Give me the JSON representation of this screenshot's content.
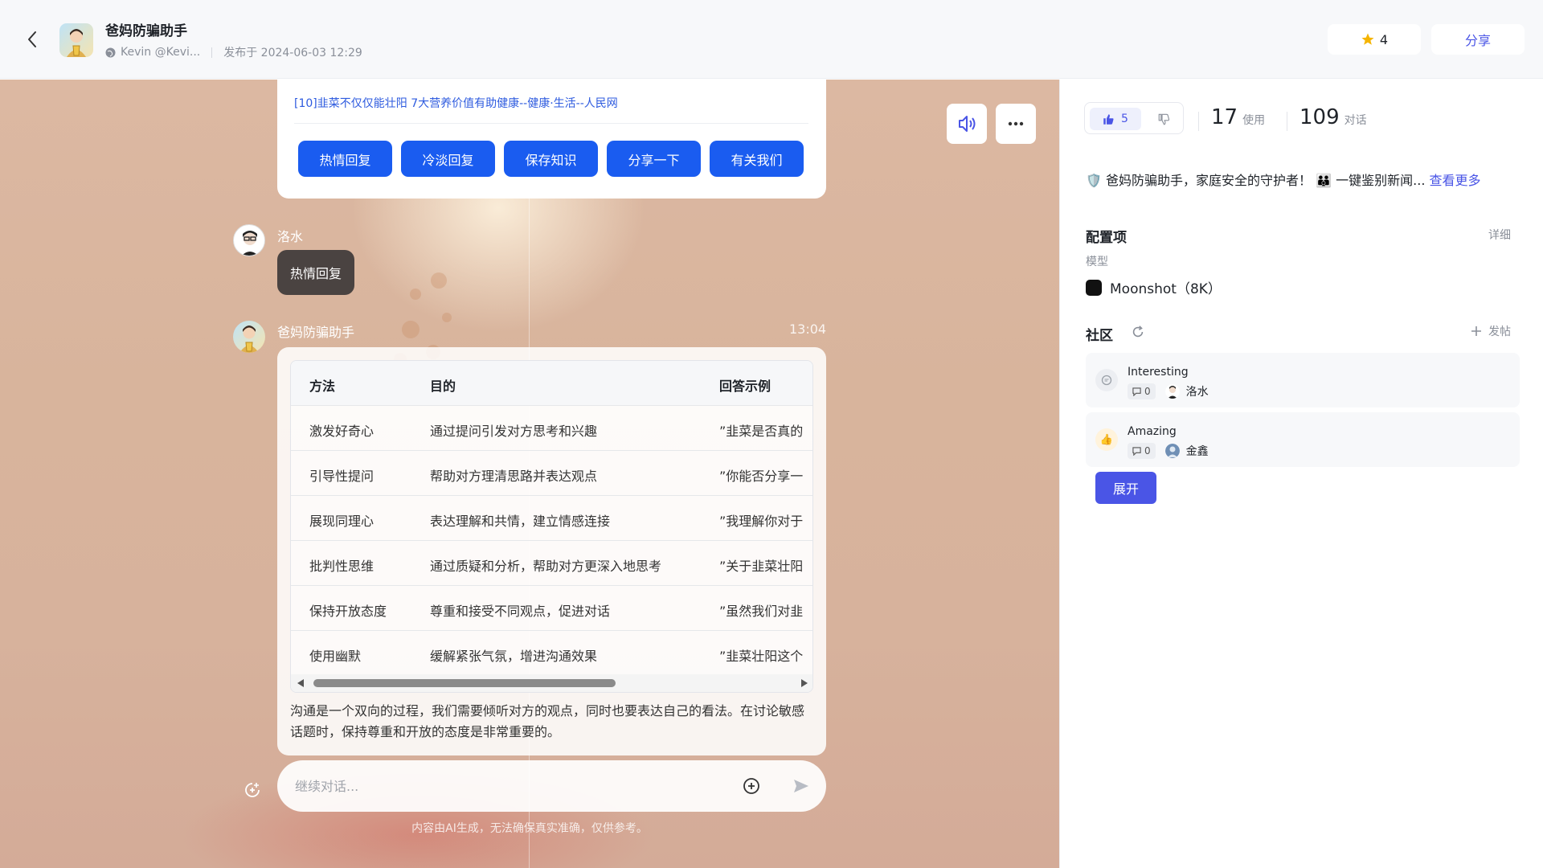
{
  "header": {
    "title": "爸妈防骗助手",
    "author": "Kevin @Kevi...",
    "published": "发布于 2024-06-03 12:29",
    "star_count": "4",
    "share_label": "分享"
  },
  "chat": {
    "reference_link": "[10]韭菜不仅仅能壮阳 7大营养价值有助健康--健康·生活--人民网",
    "quick_replies": [
      "热情回复",
      "冷淡回复",
      "保存知识",
      "分享一下",
      "有关我们"
    ],
    "user_message": {
      "name": "洛水",
      "text": "热情回复"
    },
    "bot_message": {
      "name": "爸妈防骗助手",
      "time": "13:04",
      "table": {
        "headers": [
          "方法",
          "目的",
          "回答示例"
        ],
        "rows": [
          [
            "激发好奇心",
            "通过提问引发对方思考和兴趣",
            "”韭菜是否真的"
          ],
          [
            "引导性提问",
            "帮助对方理清思路并表达观点",
            "”你能否分享一"
          ],
          [
            "展现同理心",
            "表达理解和共情，建立情感连接",
            "”我理解你对于"
          ],
          [
            "批判性思维",
            "通过质疑和分析，帮助对方更深入地思考",
            "”关于韭菜壮阳"
          ],
          [
            "保持开放态度",
            "尊重和接受不同观点，促进对话",
            "”虽然我们对韭"
          ],
          [
            "使用幽默",
            "缓解紧张气氛，增进沟通效果",
            "”韭菜壮阳这个"
          ]
        ]
      },
      "summary": "沟通是一个双向的过程，我们需要倾听对方的观点，同时也要表达自己的看法。在讨论敏感话题时，保持尊重和开放的态度是非常重要的。"
    },
    "input_placeholder": "继续对话...",
    "disclaimer": "内容由AI生成，无法确保真实准确，仅供参考。"
  },
  "panel": {
    "likes": "5",
    "uses": "17",
    "uses_label": "使用",
    "conversations": "109",
    "conversations_label": "对话",
    "description": "爸妈防骗助手，家庭安全的守护者！",
    "description_tail": "一键鉴别新闻...",
    "see_more": "查看更多",
    "config_title": "配置项",
    "config_detail": "详细",
    "model_label": "模型",
    "model_name": "Moonshot（8K）",
    "community_title": "社区",
    "post_label": "发帖",
    "posts": [
      {
        "title": "Interesting",
        "comments": "0",
        "author": "洛水",
        "icon": "chat-icon"
      },
      {
        "title": "Amazing",
        "comments": "0",
        "author": "金鑫",
        "icon": "thumbs-up-emoji"
      }
    ],
    "expand_label": "展开"
  },
  "colors": {
    "accent": "#4a55e6",
    "quick_reply_bg": "#1a5cf0",
    "user_bubble": "#4a4341"
  }
}
